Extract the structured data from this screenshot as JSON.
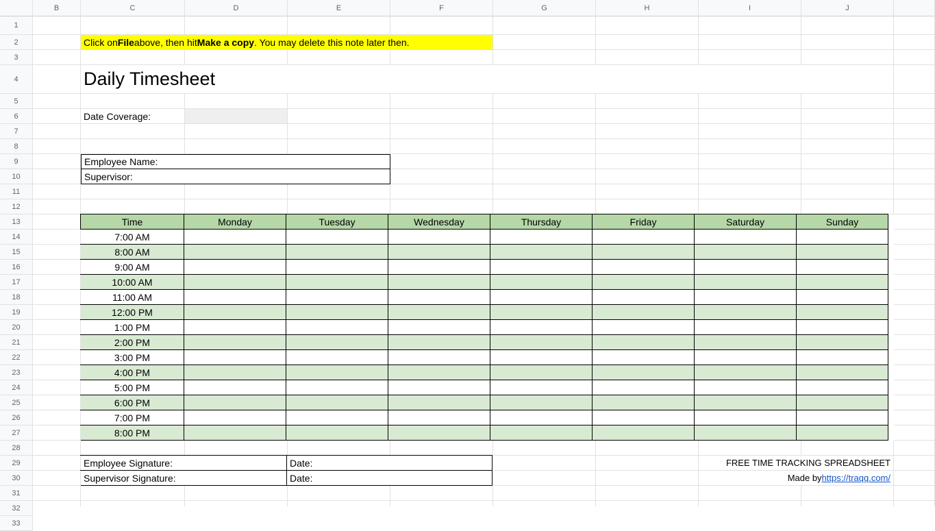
{
  "columns": [
    "B",
    "C",
    "D",
    "E",
    "F",
    "G",
    "H",
    "I",
    "J"
  ],
  "rows_count": 33,
  "note": {
    "pre": "Click on ",
    "bold1": "File",
    "mid": " above, then hit ",
    "bold2": "Make a copy",
    "post": ". You may delete this note later then."
  },
  "title": "Daily Timesheet",
  "date_coverage_label": "Date Coverage:",
  "employee_name_label": "Employee Name:",
  "supervisor_label": "Supervisor:",
  "table": {
    "headers": [
      "Time",
      "Monday",
      "Tuesday",
      "Wednesday",
      "Thursday",
      "Friday",
      "Saturday",
      "Sunday"
    ],
    "times": [
      "7:00 AM",
      "8:00 AM",
      "9:00 AM",
      "10:00 AM",
      "11:00 AM",
      "12:00 PM",
      "1:00 PM",
      "2:00 PM",
      "3:00 PM",
      "4:00 PM",
      "5:00 PM",
      "6:00 PM",
      "7:00 PM",
      "8:00 PM"
    ]
  },
  "signature": {
    "emp_sig": "Employee Signature:",
    "sup_sig": "Supervisor Signature:",
    "date": "Date:"
  },
  "footer": {
    "line1": "FREE TIME TRACKING SPREADSHEET",
    "line2_pre": "Made by ",
    "line2_link": "https://traqq.com/"
  }
}
